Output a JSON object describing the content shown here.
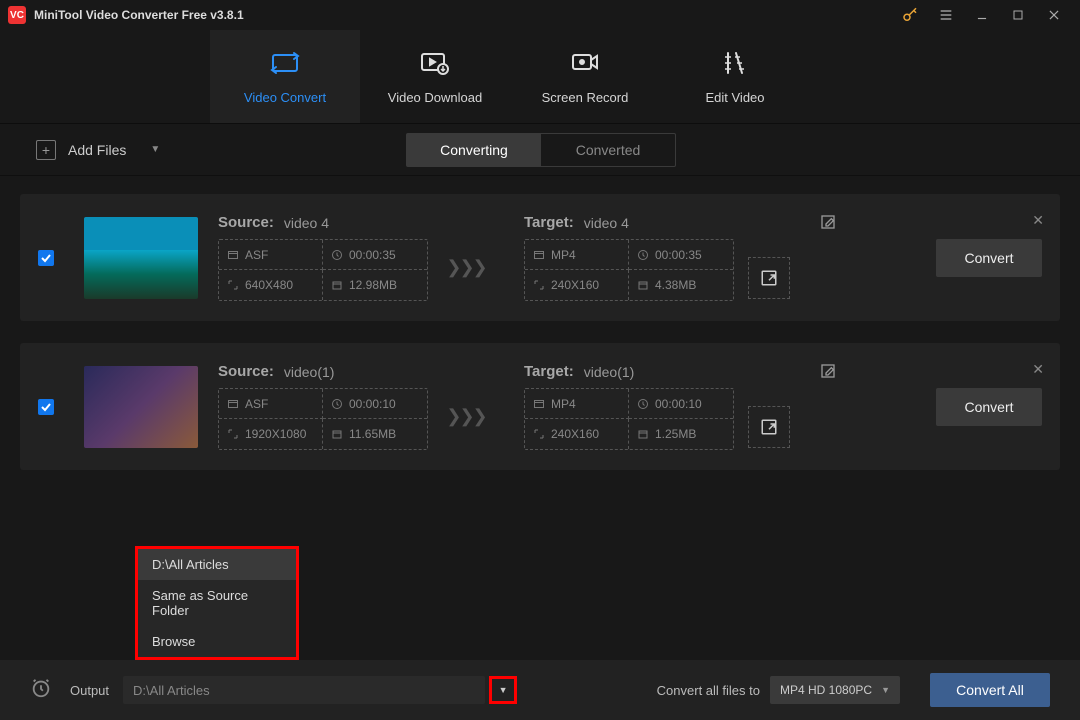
{
  "titlebar": {
    "app_title": "MiniTool Video Converter Free v3.8.1"
  },
  "nav": {
    "tabs": [
      {
        "label": "Video Convert"
      },
      {
        "label": "Video Download"
      },
      {
        "label": "Screen Record"
      },
      {
        "label": "Edit Video"
      }
    ]
  },
  "toolbar": {
    "add_files": "Add Files",
    "tabs": {
      "converting": "Converting",
      "converted": "Converted"
    }
  },
  "files": [
    {
      "source_label": "Source:",
      "source_name": "video 4",
      "src_format": "ASF",
      "src_duration": "00:00:35",
      "src_res": "640X480",
      "src_size": "12.98MB",
      "target_label": "Target:",
      "target_name": "video 4",
      "tgt_format": "MP4",
      "tgt_duration": "00:00:35",
      "tgt_res": "240X160",
      "tgt_size": "4.38MB",
      "convert_btn": "Convert"
    },
    {
      "source_label": "Source:",
      "source_name": "video(1)",
      "src_format": "ASF",
      "src_duration": "00:00:10",
      "src_res": "1920X1080",
      "src_size": "11.65MB",
      "target_label": "Target:",
      "target_name": "video(1)",
      "tgt_format": "MP4",
      "tgt_duration": "00:00:10",
      "tgt_res": "240X160",
      "tgt_size": "1.25MB",
      "convert_btn": "Convert"
    }
  ],
  "output_menu": {
    "items": [
      "D:\\All Articles",
      "Same as Source Folder",
      "Browse"
    ]
  },
  "bottombar": {
    "output_label": "Output",
    "output_path": "D:\\All Articles",
    "convert_all_to_label": "Convert all files to",
    "format_selected": "MP4 HD 1080PC",
    "convert_all": "Convert All"
  }
}
